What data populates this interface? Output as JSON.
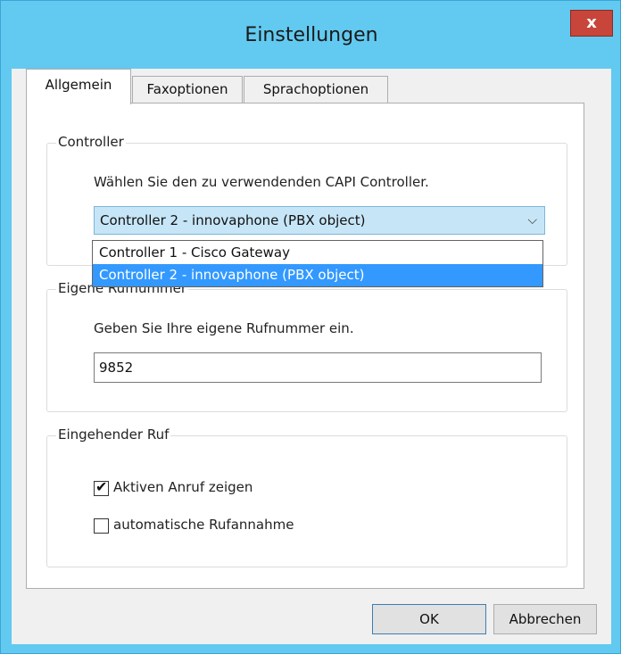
{
  "window": {
    "title": "Einstellungen",
    "close_label": "x"
  },
  "tabs": [
    {
      "label": "Allgemein",
      "active": true
    },
    {
      "label": "Faxoptionen",
      "active": false
    },
    {
      "label": "Sprachoptionen",
      "active": false
    }
  ],
  "controller": {
    "legend": "Controller",
    "instruction": "Wählen Sie den zu verwendenden CAPI Controller.",
    "selected": "Controller 2 - innovaphone (PBX object)",
    "arrow_icon": "chevron-down-icon",
    "options": [
      "Controller 1 - Cisco Gateway",
      "Controller 2 - innovaphone (PBX object)"
    ]
  },
  "rufnummer": {
    "legend": "Eigene Rufnummer",
    "instruction": "Geben Sie Ihre eigene Rufnummer ein.",
    "value": "9852"
  },
  "eingehender_ruf": {
    "legend": "Eingehender Ruf",
    "options": [
      {
        "label": "Aktiven Anruf zeigen",
        "checked": true
      },
      {
        "label": "automatische Rufannahme",
        "checked": false
      }
    ]
  },
  "buttons": {
    "ok": "OK",
    "cancel": "Abbrechen"
  }
}
